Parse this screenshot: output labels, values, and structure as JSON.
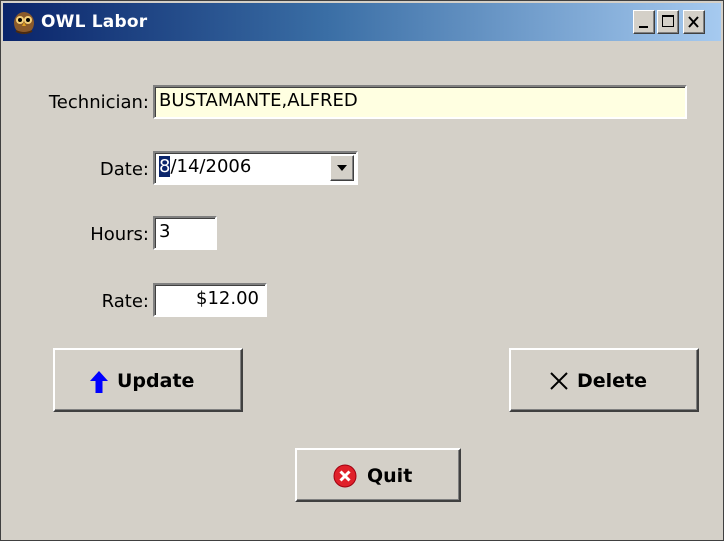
{
  "window": {
    "title": "OWL Labor",
    "app_icon": "owl-icon",
    "controls": [
      "minimize-icon",
      "maximize-icon",
      "close-icon"
    ]
  },
  "form": {
    "technician_label": "Technician:",
    "technician_value": "BUSTAMANTE,ALFRED",
    "date_label": "Date:",
    "date_selected_part": "8",
    "date_rest": "/14/2006",
    "hours_label": "Hours:",
    "hours_value": "3",
    "rate_label": "Rate:",
    "rate_value": "$12.00"
  },
  "buttons": {
    "update": "Update",
    "delete": "Delete",
    "quit": "Quit"
  },
  "icons": {
    "update": "arrow-up-icon",
    "delete": "x-icon",
    "quit": "quit-icon",
    "dropdown": "chevron-down-icon"
  },
  "colors": {
    "titlebar_start": "#0a246a",
    "titlebar_end": "#a6caf0",
    "dialog_bg": "#d4d0c8",
    "technician_field_bg": "#ffffe1",
    "update_arrow": "#0000ff",
    "quit_icon": "#e0202a"
  }
}
